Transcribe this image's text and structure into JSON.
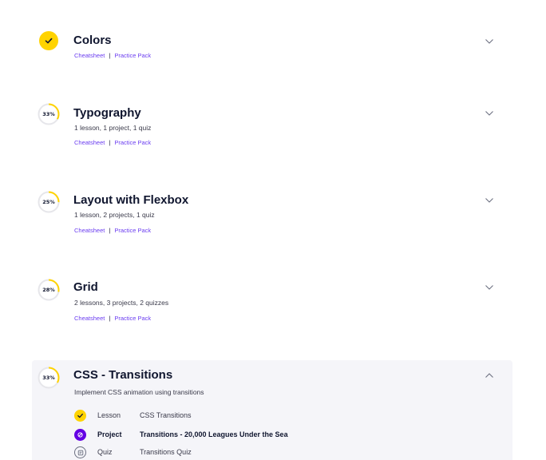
{
  "modules": [
    {
      "title": "Colors",
      "status": "complete",
      "meta": "",
      "links": [
        "Cheatsheet",
        "Practice Pack"
      ]
    },
    {
      "title": "Typography",
      "status": "in-progress",
      "progress_label": "33%",
      "progress": 0.33,
      "meta": "1 lesson, 1 project, 1 quiz",
      "links": [
        "Cheatsheet",
        "Practice Pack"
      ]
    },
    {
      "title": "Layout with Flexbox",
      "status": "in-progress",
      "progress_label": "25%",
      "progress": 0.25,
      "meta": "1 lesson, 2 projects, 1 quiz",
      "links": [
        "Cheatsheet",
        "Practice Pack"
      ]
    },
    {
      "title": "Grid",
      "status": "in-progress",
      "progress_label": "28%",
      "progress": 0.28,
      "meta": "2 lessons, 3 projects, 2 quizzes",
      "links": [
        "Cheatsheet",
        "Practice Pack"
      ]
    },
    {
      "title": "CSS - Transitions",
      "status": "in-progress",
      "progress_label": "33%",
      "progress": 0.33,
      "meta": "Implement CSS animation using transitions",
      "expanded": true,
      "items": [
        {
          "type": "Lesson",
          "name": "CSS Transitions",
          "icon": "check-circle-icon",
          "state": "complete"
        },
        {
          "type": "Project",
          "name": "Transitions - 20,000 Leagues Under the Sea",
          "icon": "project-icon",
          "state": "current"
        },
        {
          "type": "Quiz",
          "name": "Transitions Quiz",
          "icon": "quiz-icon",
          "state": "todo"
        }
      ]
    }
  ],
  "separator": "|",
  "colors": {
    "accent_yellow": "#ffd300",
    "link_purple": "#6b3df0",
    "project_purple": "#6400e4",
    "ring_track": "#e6e6ea",
    "text_dark": "#10162f",
    "expanded_bg": "#f5f5f9"
  }
}
